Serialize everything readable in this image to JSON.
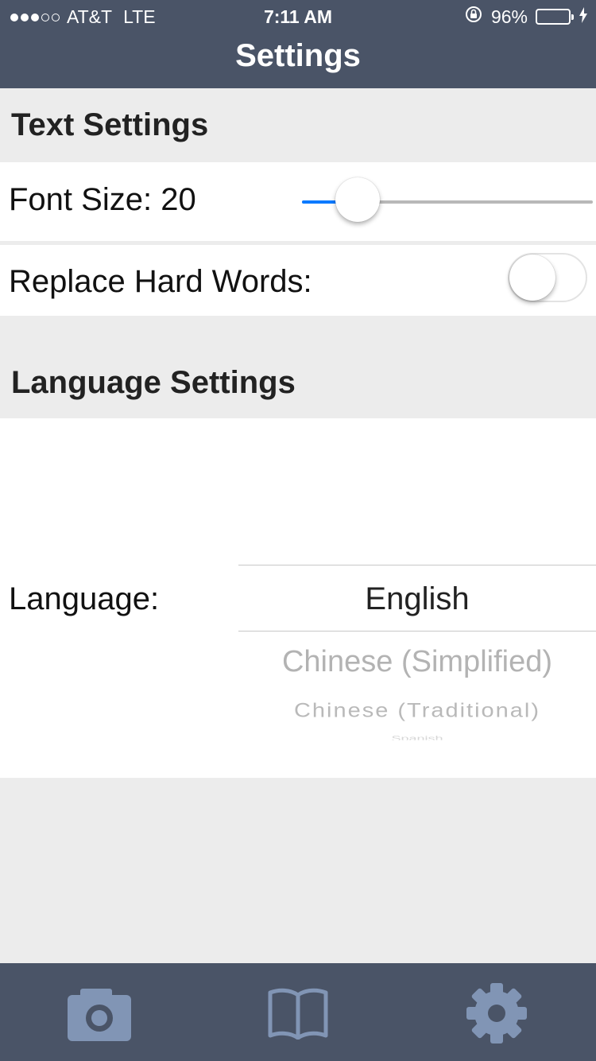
{
  "status_bar": {
    "carrier": "AT&T",
    "network": "LTE",
    "time": "7:11 AM",
    "battery": "96%"
  },
  "nav": {
    "title": "Settings"
  },
  "text_settings": {
    "header": "Text Settings",
    "font_size_label": "Font Size: 20",
    "font_size_slider_fraction": 0.19,
    "replace_hard_words_label": "Replace Hard Words:",
    "replace_hard_words_on": false
  },
  "language_settings": {
    "header": "Language Settings",
    "language_label": "Language:",
    "picker_selected": "English",
    "picker_next_1": "Chinese (Simplified)",
    "picker_next_2": "Chinese (Traditional)",
    "picker_next_3": "Spanish"
  },
  "tabbar": {
    "tabs": [
      {
        "icon": "camera-icon",
        "active": false
      },
      {
        "icon": "book-icon",
        "active": false
      },
      {
        "icon": "gear-icon",
        "active": true
      }
    ]
  },
  "colors": {
    "bar_background": "#4a5467",
    "tab_icon": "#8195b5",
    "slider_accent": "#0a7aff",
    "battery_fill": "#4cd964"
  }
}
